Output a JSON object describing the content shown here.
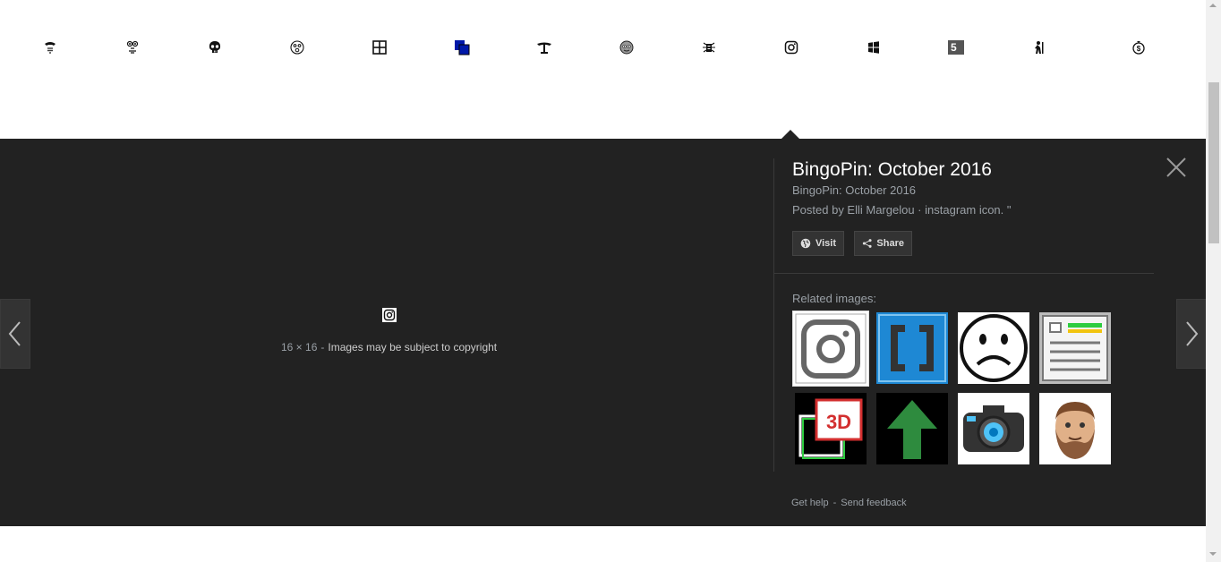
{
  "results_strip": {
    "thumbnails": [
      {
        "icon": "telephone-icon"
      },
      {
        "icon": "face-icon"
      },
      {
        "icon": "skull-icon"
      },
      {
        "icon": "surprised-face-icon"
      },
      {
        "icon": "grid-icon"
      },
      {
        "icon": "overlapping-squares-icon"
      },
      {
        "icon": "scale-icon"
      },
      {
        "icon": "smiley-icon"
      },
      {
        "icon": "bug-icon"
      },
      {
        "icon": "instagram-icon"
      },
      {
        "icon": "windows-icon"
      },
      {
        "icon": "number-tile-icon",
        "text": "5"
      },
      {
        "icon": "figure-icon"
      },
      {
        "icon": "dollar-coin-icon"
      }
    ]
  },
  "viewer": {
    "title": "BingoPin: October 2016",
    "subtitle": "BingoPin: October 2016",
    "description": "Posted by Elli Margelou · instagram icon. \"",
    "visit_label": "Visit",
    "share_label": "Share",
    "image_size": "16 × 16",
    "caption_separator": "-",
    "copyright_text": "Images may be subject to copyright",
    "related_label": "Related images:",
    "related_images": [
      {
        "icon": "instagram-icon",
        "selected": true
      },
      {
        "icon": "brackets-icon"
      },
      {
        "icon": "sad-face-icon"
      },
      {
        "icon": "document-icon"
      },
      {
        "icon": "3d-icon",
        "text": "3D"
      },
      {
        "icon": "green-arrow-up-icon"
      },
      {
        "icon": "camera-icon"
      },
      {
        "icon": "bearded-face-icon"
      }
    ],
    "footer": {
      "help_label": "Get help",
      "separator": "-",
      "feedback_label": "Send feedback"
    }
  },
  "colors": {
    "viewer_background": "#222222",
    "title_text": "#ffffff",
    "muted_text": "#9aa0a6",
    "button_background": "#333333"
  }
}
